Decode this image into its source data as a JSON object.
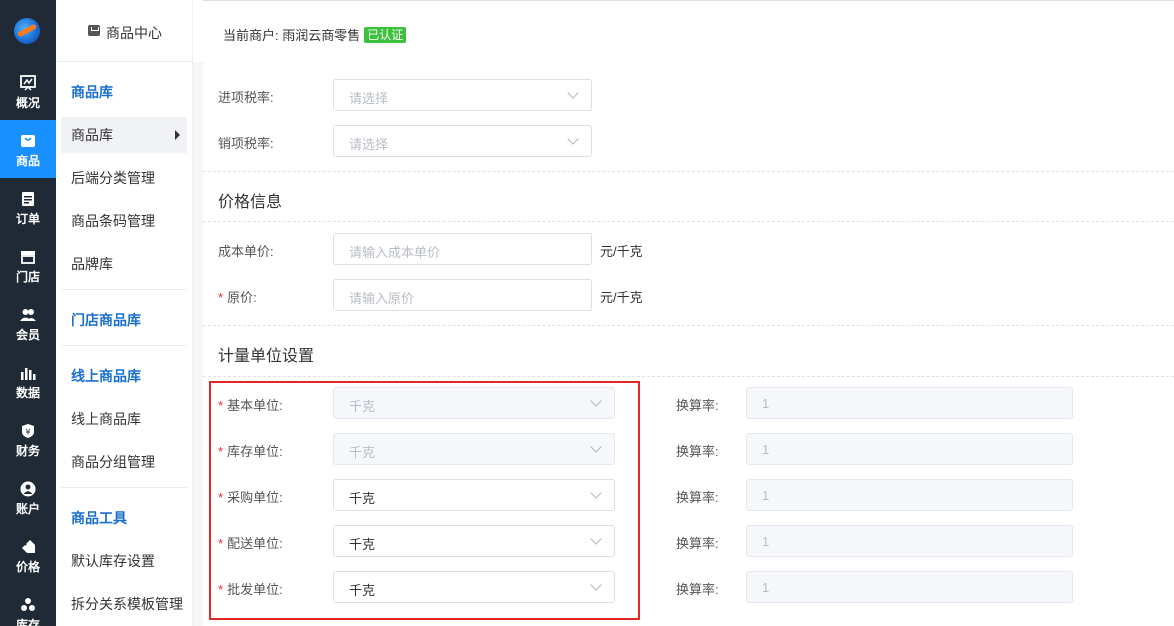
{
  "rail": {
    "items": [
      {
        "label": "概况",
        "icon": "dashboard-icon"
      },
      {
        "label": "商品",
        "icon": "goods-icon"
      },
      {
        "label": "订单",
        "icon": "order-icon"
      },
      {
        "label": "门店",
        "icon": "store-icon"
      },
      {
        "label": "会员",
        "icon": "member-icon"
      },
      {
        "label": "数据",
        "icon": "chart-icon"
      },
      {
        "label": "财务",
        "icon": "finance-icon"
      },
      {
        "label": "账户",
        "icon": "account-icon"
      },
      {
        "label": "价格",
        "icon": "price-tag-icon"
      },
      {
        "label": "库存",
        "icon": "inventory-icon"
      }
    ],
    "active_index": 1,
    "active_color": "#1890ff",
    "bg_color": "#1f2a36"
  },
  "sidebar": {
    "header": "商品中心",
    "groups": [
      {
        "title": "商品库",
        "items": [
          "商品库",
          "后端分类管理",
          "商品条码管理",
          "品牌库"
        ]
      },
      {
        "title": "门店商品库",
        "items": []
      },
      {
        "title": "线上商品库",
        "items": [
          "线上商品库",
          "商品分组管理"
        ]
      },
      {
        "title": "商品工具",
        "items": [
          "默认库存设置",
          "拆分关系模板管理"
        ]
      }
    ],
    "active_item": "商品库"
  },
  "top": {
    "merchant_label": "当前商户: 雨润云商零售",
    "verified_badge": "已认证"
  },
  "tax": {
    "input_tax_label": "进项税率:",
    "input_tax_placeholder": "请选择",
    "output_tax_label": "销项税率:",
    "output_tax_placeholder": "请选择"
  },
  "price": {
    "section_title": "价格信息",
    "cost_label": "成本单价:",
    "cost_placeholder": "请输入成本单价",
    "cost_unit": "元/千克",
    "original_label": "原价:",
    "original_placeholder": "请输入原价",
    "original_unit": "元/千克"
  },
  "measure": {
    "section_title": "计量单位设置",
    "rate_label": "换算率:",
    "rows": [
      {
        "label": "基本单位:",
        "value": "千克",
        "rate": "1",
        "disabled": true
      },
      {
        "label": "库存单位:",
        "value": "千克",
        "rate": "1",
        "disabled": true
      },
      {
        "label": "采购单位:",
        "value": "千克",
        "rate": "1",
        "disabled": false
      },
      {
        "label": "配送单位:",
        "value": "千克",
        "rate": "1",
        "disabled": false
      },
      {
        "label": "批发单位:",
        "value": "千克",
        "rate": "1",
        "disabled": false
      }
    ],
    "required_mark": "*"
  },
  "colors": {
    "group_title": "#1a6fcf",
    "required": "#f5222d",
    "highlight_box": "#e32626",
    "badge": "#3cc13c"
  }
}
